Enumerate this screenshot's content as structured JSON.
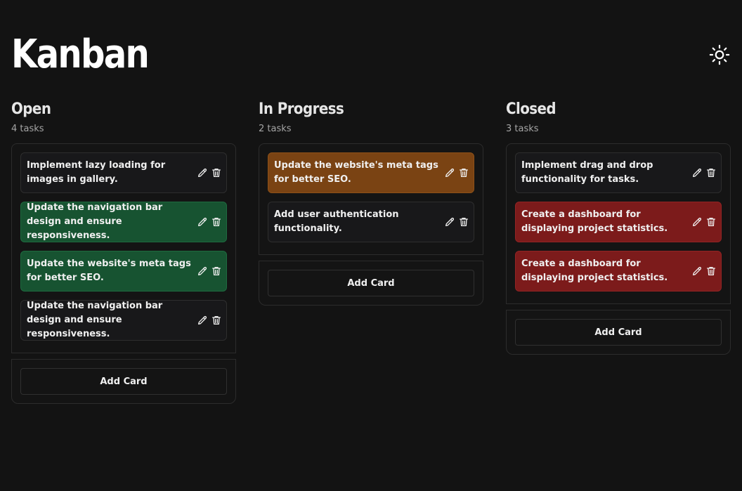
{
  "app": {
    "title": "Kanban"
  },
  "columns": [
    {
      "title": "Open",
      "count": "4 tasks",
      "add_label": "Add Card",
      "cards": [
        {
          "text": "Implement lazy loading for images in gallery.",
          "color": "default"
        },
        {
          "text": "Update the navigation bar design and ensure responsiveness.",
          "color": "green"
        },
        {
          "text": "Update the website's meta tags for better SEO.",
          "color": "green"
        },
        {
          "text": "Update the navigation bar design and ensure responsiveness.",
          "color": "default"
        }
      ]
    },
    {
      "title": "In Progress",
      "count": "2 tasks",
      "add_label": "Add Card",
      "cards": [
        {
          "text": "Update the website's meta tags for better SEO.",
          "color": "orange"
        },
        {
          "text": "Add user authentication functionality.",
          "color": "default"
        }
      ]
    },
    {
      "title": "Closed",
      "count": "3 tasks",
      "add_label": "Add Card",
      "cards": [
        {
          "text": "Implement drag and drop functionality for tasks.",
          "color": "default"
        },
        {
          "text": "Create a dashboard for displaying project statistics.",
          "color": "red"
        },
        {
          "text": "Create a dashboard for displaying project statistics.",
          "color": "red"
        }
      ]
    }
  ],
  "colors": {
    "background": "#131313",
    "card_default": "#18181a",
    "card_green": "#175331",
    "card_orange": "#7a4313",
    "card_red": "#7c1b1b"
  },
  "icons": {
    "theme_toggle": "sun-icon",
    "edit": "pencil-icon",
    "delete": "trash-icon"
  }
}
